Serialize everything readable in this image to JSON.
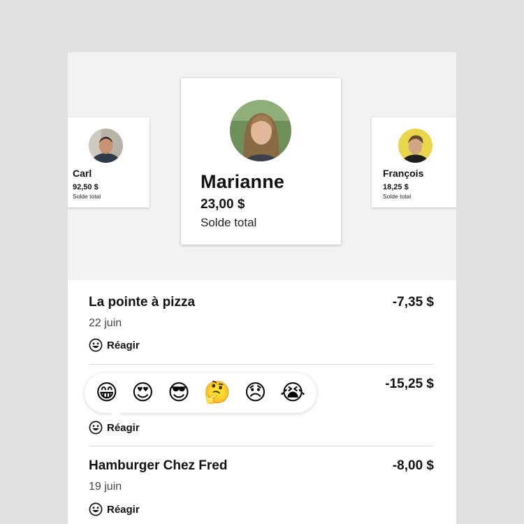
{
  "balances": {
    "left": {
      "name": "Carl",
      "amount": "92,50 $",
      "label": "Solde total"
    },
    "center": {
      "name": "Marianne",
      "amount": "23,00 $",
      "label": "Solde total"
    },
    "right": {
      "name": "François",
      "amount": "18,25 $",
      "label": "Solde total"
    }
  },
  "transactions": [
    {
      "title": "La pointe à pizza",
      "date": "22 juin",
      "amount": "-7,35 $",
      "react_label": "Réagir"
    },
    {
      "title": "",
      "date": "",
      "amount": "-15,25 $",
      "react_label": "Réagir"
    },
    {
      "title": "Hamburger Chez Fred",
      "date": "19 juin",
      "amount": "-8,00 $",
      "react_label": "Réagir"
    }
  ],
  "reaction_picker": {
    "emojis": [
      "😁",
      "😍",
      "😎",
      "🤔",
      "😞",
      "😭"
    ]
  }
}
